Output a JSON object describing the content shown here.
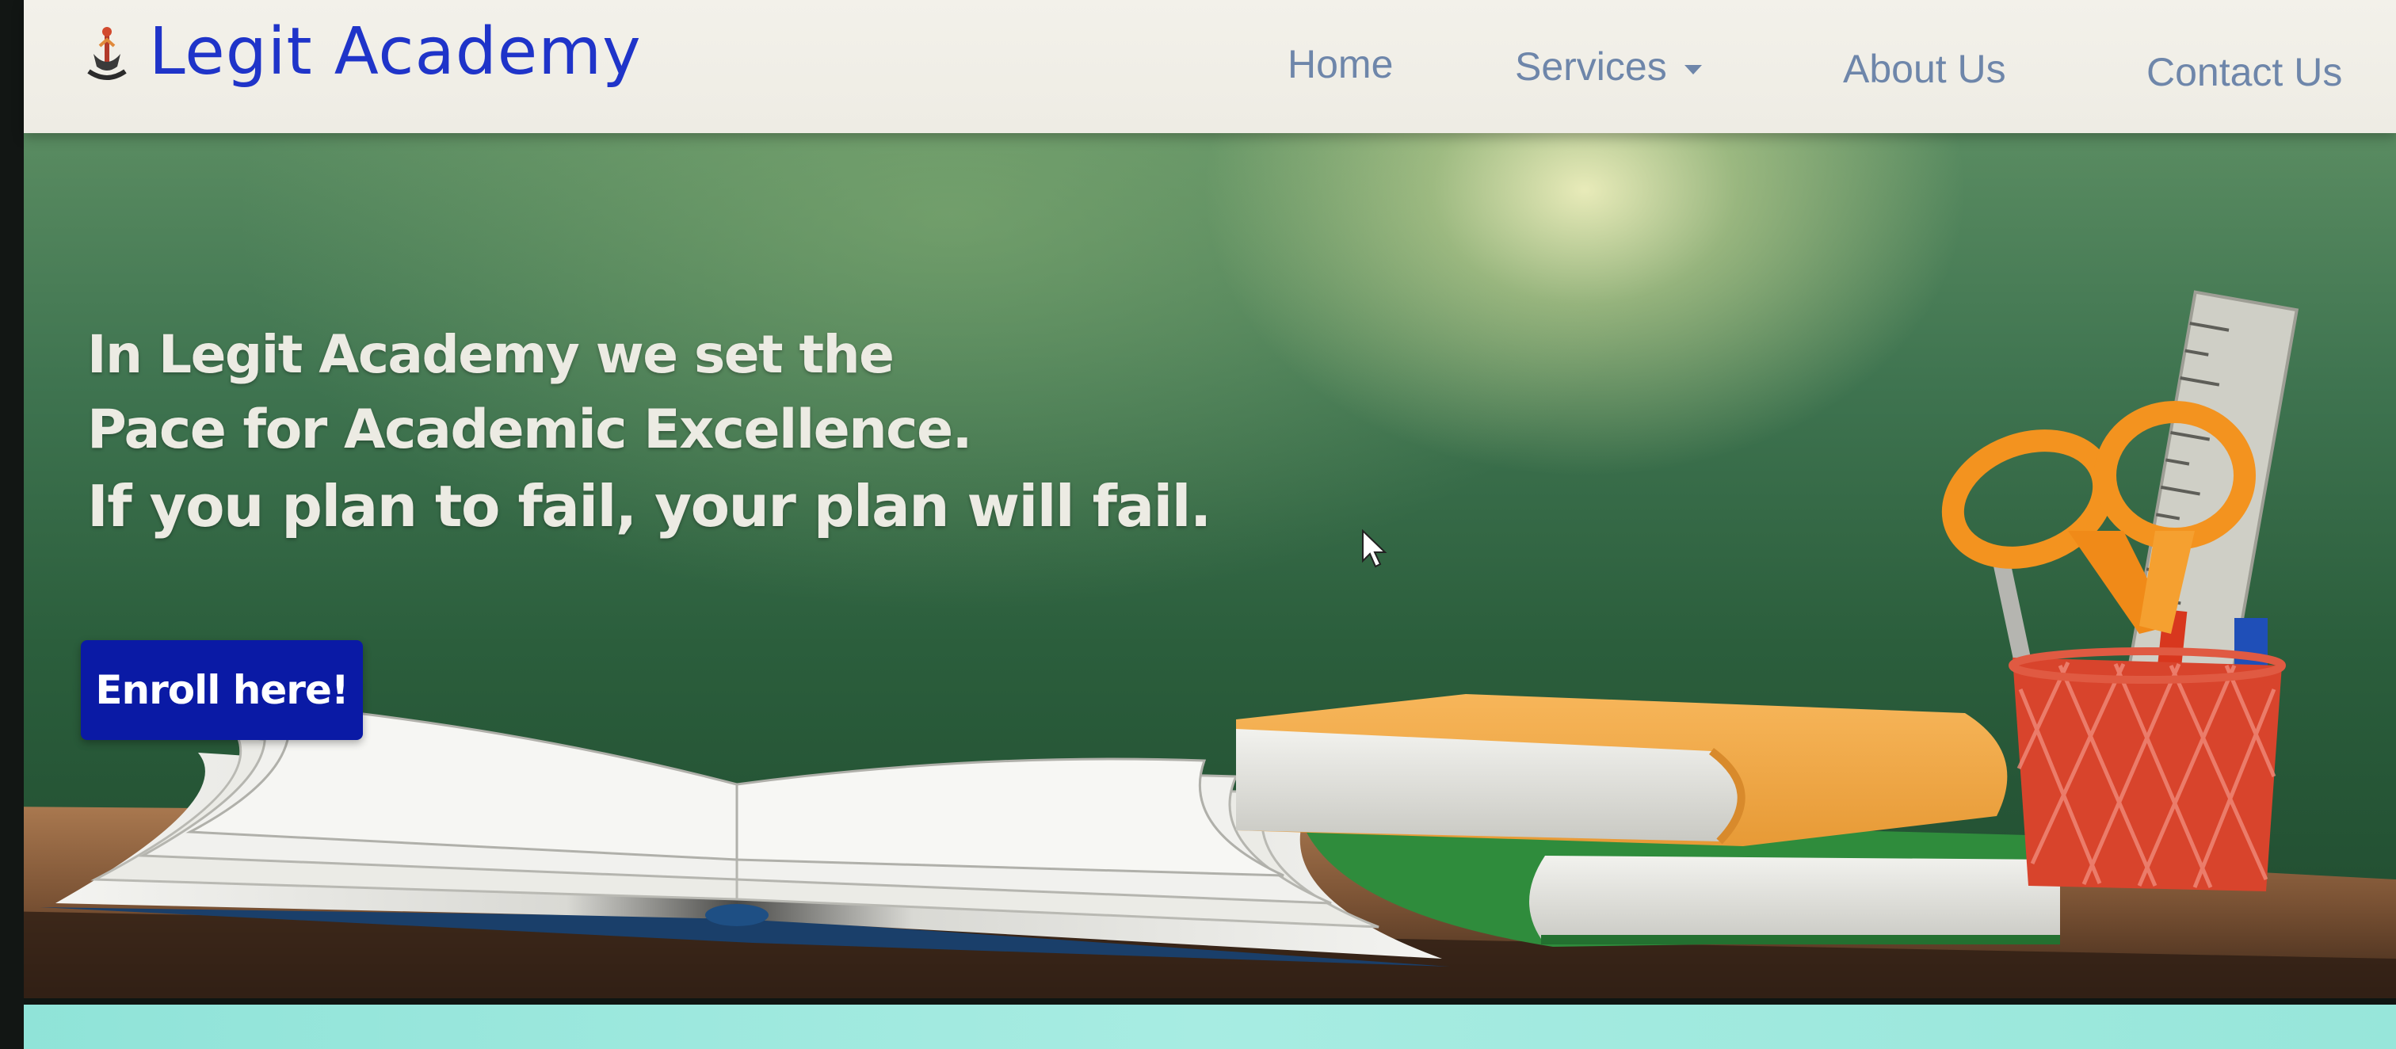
{
  "navbar": {
    "brand_name": "Legit Academy",
    "brand_icon": "academy-logo-icon",
    "links": {
      "home": "Home",
      "services": "Services",
      "about": "About Us",
      "contact": "Contact Us"
    }
  },
  "hero": {
    "line1": "In Legit Academy we set the",
    "line2": "Pace for Academic Excellence.",
    "line3": "If you plan to fail, your plan will fail.",
    "enroll_button": "Enroll here!"
  },
  "colors": {
    "brand_blue": "#1f34c9",
    "nav_link": "#6e86aa",
    "button_blue": "#0a1aa5",
    "chalkboard_green": "#2b5e3c",
    "navbar_bg": "#f3f1ea"
  }
}
